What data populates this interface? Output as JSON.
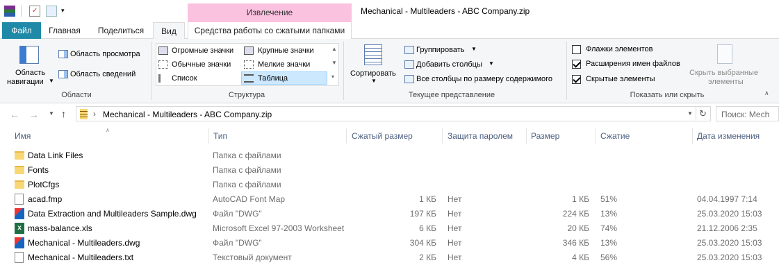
{
  "titlebar": {
    "contextual_group": "Извлечение",
    "window_title": "Mechanical - Multileaders - ABC Company.zip"
  },
  "tabs": {
    "file": "Файл",
    "home": "Главная",
    "share": "Поделиться",
    "view": "Вид",
    "compressed_tools": "Средства работы со сжатыми папками"
  },
  "ribbon": {
    "panes": {
      "nav_pane_line1": "Область",
      "nav_pane_line2": "навигации",
      "preview_pane": "Область просмотра",
      "details_pane": "Область сведений",
      "group_label": "Области"
    },
    "layout": {
      "huge_icons": "Огромные значки",
      "large_icons": "Крупные значки",
      "medium_icons": "Обычные значки",
      "small_icons": "Мелкие значки",
      "list": "Список",
      "details": "Таблица",
      "group_label": "Структура"
    },
    "current_view": {
      "sort_by": "Сортировать",
      "group_by": "Группировать",
      "add_columns": "Добавить столбцы",
      "size_all_columns": "Все столбцы по размеру содержимого",
      "group_label": "Текущее представление"
    },
    "show_hide": {
      "item_checkboxes": "Флажки элементов",
      "file_extensions": "Расширения имен файлов",
      "hidden_items": "Скрытые элементы",
      "hide_selected_line1": "Скрыть выбранные",
      "hide_selected_line2": "элементы",
      "group_label": "Показать или скрыть"
    }
  },
  "address": {
    "path": "Mechanical - Multileaders - ABC Company.zip",
    "search_placeholder": "Поиск: Mech"
  },
  "columns": {
    "name": "Имя",
    "type": "Тип",
    "packed": "Сжатый размер",
    "password": "Защита паролем",
    "size": "Размер",
    "ratio": "Сжатие",
    "modified": "Дата изменения"
  },
  "files": [
    {
      "name": "Data Link Files",
      "type": "Папка с файлами",
      "packed": "",
      "password": "",
      "size": "",
      "ratio": "",
      "modified": ""
    },
    {
      "name": "Fonts",
      "type": "Папка с файлами",
      "packed": "",
      "password": "",
      "size": "",
      "ratio": "",
      "modified": ""
    },
    {
      "name": "PlotCfgs",
      "type": "Папка с файлами",
      "packed": "",
      "password": "",
      "size": "",
      "ratio": "",
      "modified": ""
    },
    {
      "name": "acad.fmp",
      "type": "AutoCAD Font Map",
      "packed": "1 КБ",
      "password": "Нет",
      "size": "1 КБ",
      "ratio": "51%",
      "modified": "04.04.1997 7:14"
    },
    {
      "name": "Data Extraction and Multileaders Sample.dwg",
      "type": "Файл \"DWG\"",
      "packed": "197 КБ",
      "password": "Нет",
      "size": "224 КБ",
      "ratio": "13%",
      "modified": "25.03.2020 15:03"
    },
    {
      "name": "mass-balance.xls",
      "type": "Microsoft Excel 97-2003 Worksheet",
      "packed": "6 КБ",
      "password": "Нет",
      "size": "20 КБ",
      "ratio": "74%",
      "modified": "21.12.2006 2:35"
    },
    {
      "name": "Mechanical - Multileaders.dwg",
      "type": "Файл \"DWG\"",
      "packed": "304 КБ",
      "password": "Нет",
      "size": "346 КБ",
      "ratio": "13%",
      "modified": "25.03.2020 15:03"
    },
    {
      "name": "Mechanical - Multileaders.txt",
      "type": "Текстовый документ",
      "packed": "2 КБ",
      "password": "Нет",
      "size": "4 КБ",
      "ratio": "56%",
      "modified": "25.03.2020 15:03"
    }
  ]
}
